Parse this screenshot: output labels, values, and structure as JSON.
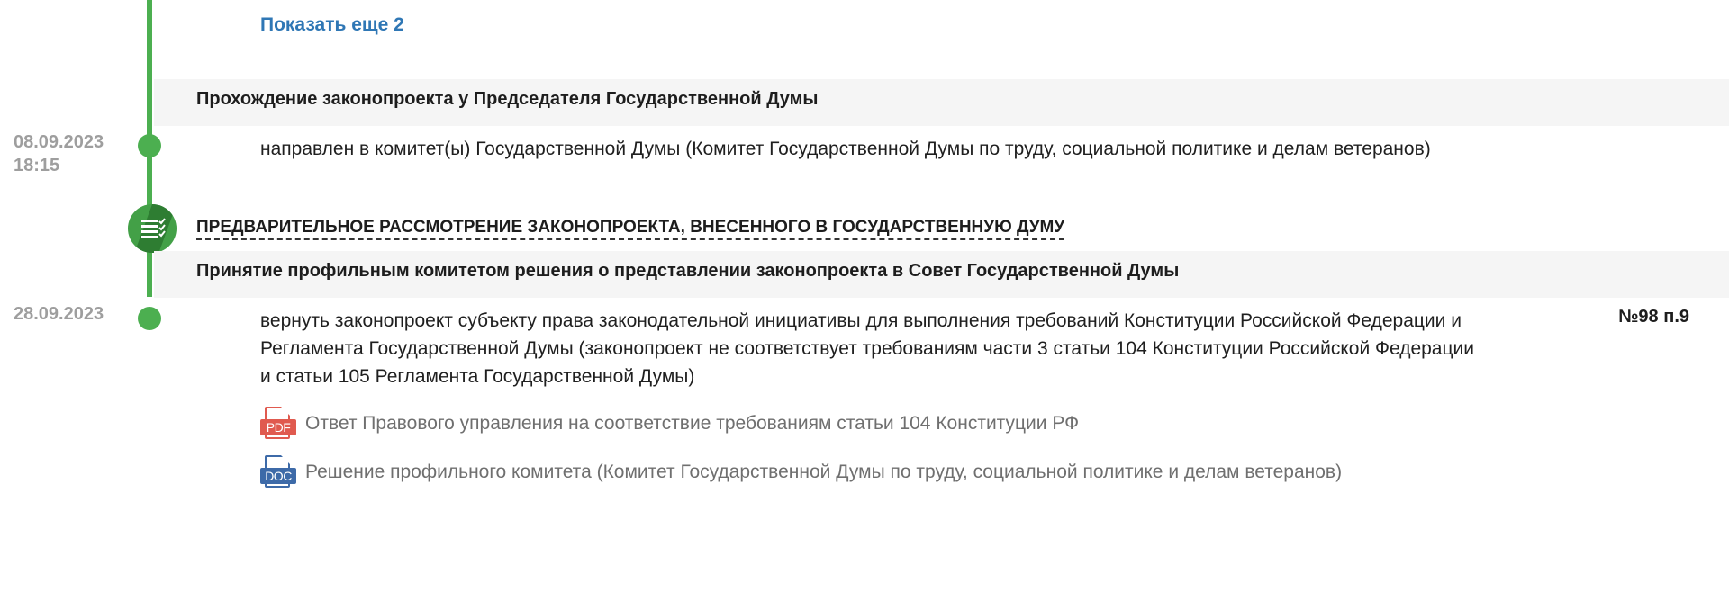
{
  "show_more": {
    "label": "Показать еще 2"
  },
  "stage1": {
    "title": "Прохождение законопроекта у Председателя Государственной Думы",
    "event": {
      "date": "08.09.2023",
      "time": "18:15",
      "text": "направлен в комитет(ы) Государственной Думы (Комитет Государственной Думы по труду, социальной политике и делам ветеранов)"
    }
  },
  "phase": {
    "title": "ПРЕДВАРИТЕЛЬНОЕ РАССМОТРЕНИЕ ЗАКОНОПРОЕКТА, ВНЕСЕННОГО В ГОСУДАРСТВЕННУЮ ДУМУ",
    "icon": "document-list-icon"
  },
  "stage2": {
    "title": "Принятие профильным комитетом решения о представлении законопроекта в Совет Государственной Думы",
    "event": {
      "date": "28.09.2023",
      "text": "вернуть законопроект субъекту права законодательной инициативы для выполнения требований Конституции Российской Федерации и Регламента Государственной Думы (законопроект не соответствует требованиям части 3 статьи 104 Конституции Российской Федерации и статьи 105 Регламента Государственной Думы)",
      "protocol": "№98 п.9"
    },
    "documents": [
      {
        "type": "PDF",
        "label": "Ответ Правового управления на соответствие требованиям статьи 104 Конституции РФ"
      },
      {
        "type": "DOC",
        "label": "Решение профильного комитета (Комитет Государственной Думы по труду, социальной политике и делам ветеранов)"
      }
    ]
  },
  "colors": {
    "timeline": "#4caf50",
    "link": "#2f77b5",
    "date": "#9e9e9e",
    "pdf": "#e05a4f",
    "doc": "#3d6aa8"
  }
}
